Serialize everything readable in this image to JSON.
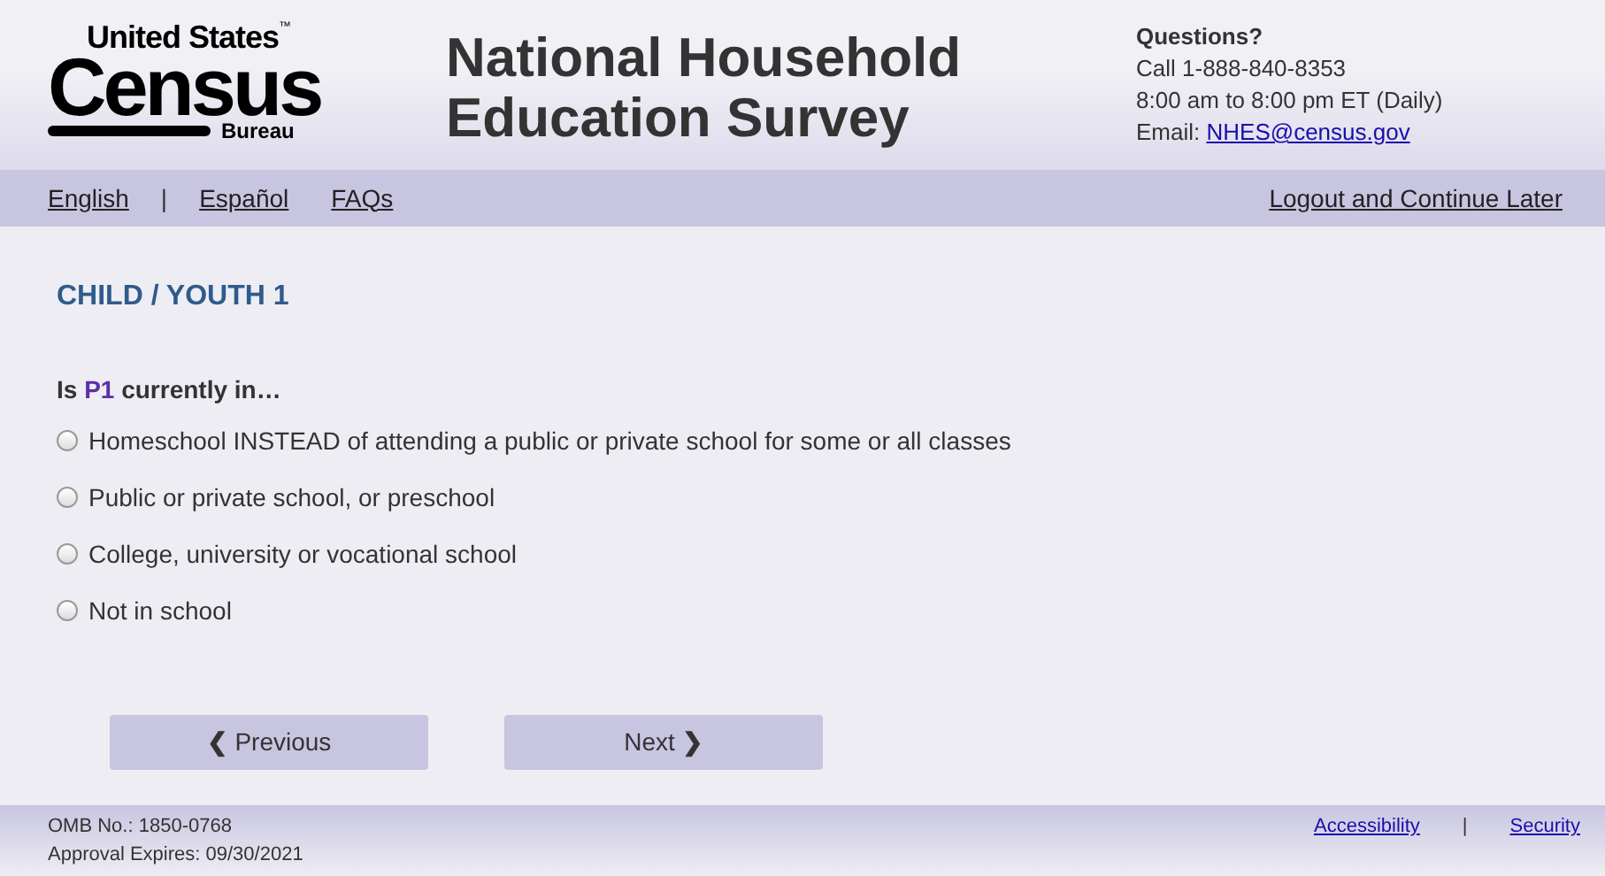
{
  "logo": {
    "top": "United States",
    "tm": "™",
    "main": "Census",
    "bottom": "Bureau"
  },
  "survey_title": [
    "National Household",
    "Education Survey"
  ],
  "contact": {
    "heading": "Questions?",
    "phone": "Call 1-888-840-8353",
    "hours": "8:00 am to 8:00 pm ET (Daily)",
    "email_label": "Email:",
    "email": "NHES@census.gov"
  },
  "nav": {
    "links": [
      {
        "label": "English"
      },
      {
        "kind": "separator",
        "label": "|"
      },
      {
        "label": "Español"
      },
      {
        "label": "FAQs"
      }
    ],
    "right": "Logout and Continue Later"
  },
  "section_title": "CHILD / YOUTH 1",
  "question": "Is **P1** currently in…",
  "options": [
    {
      "label": "Homeschool INSTEAD of attending a public or private school for some or all classes",
      "selected": false
    },
    {
      "label": "Public or private school, or preschool",
      "selected": false
    },
    {
      "label": "College, university or vocational school",
      "selected": false
    },
    {
      "label": "Not in school",
      "selected": false
    }
  ],
  "buttons": [
    {
      "label": "Previous",
      "kind": "prev",
      "icon": "❮"
    },
    {
      "label": "Next",
      "kind": "next",
      "icon": "❯"
    }
  ],
  "footer": {
    "omb": "OMB No.: 1850-0768",
    "expires": "Approval Expires: 09/30/2021",
    "links": [
      {
        "label": "Accessibility"
      },
      {
        "kind": "separator",
        "label": "|"
      },
      {
        "label": "Security"
      }
    ]
  }
}
